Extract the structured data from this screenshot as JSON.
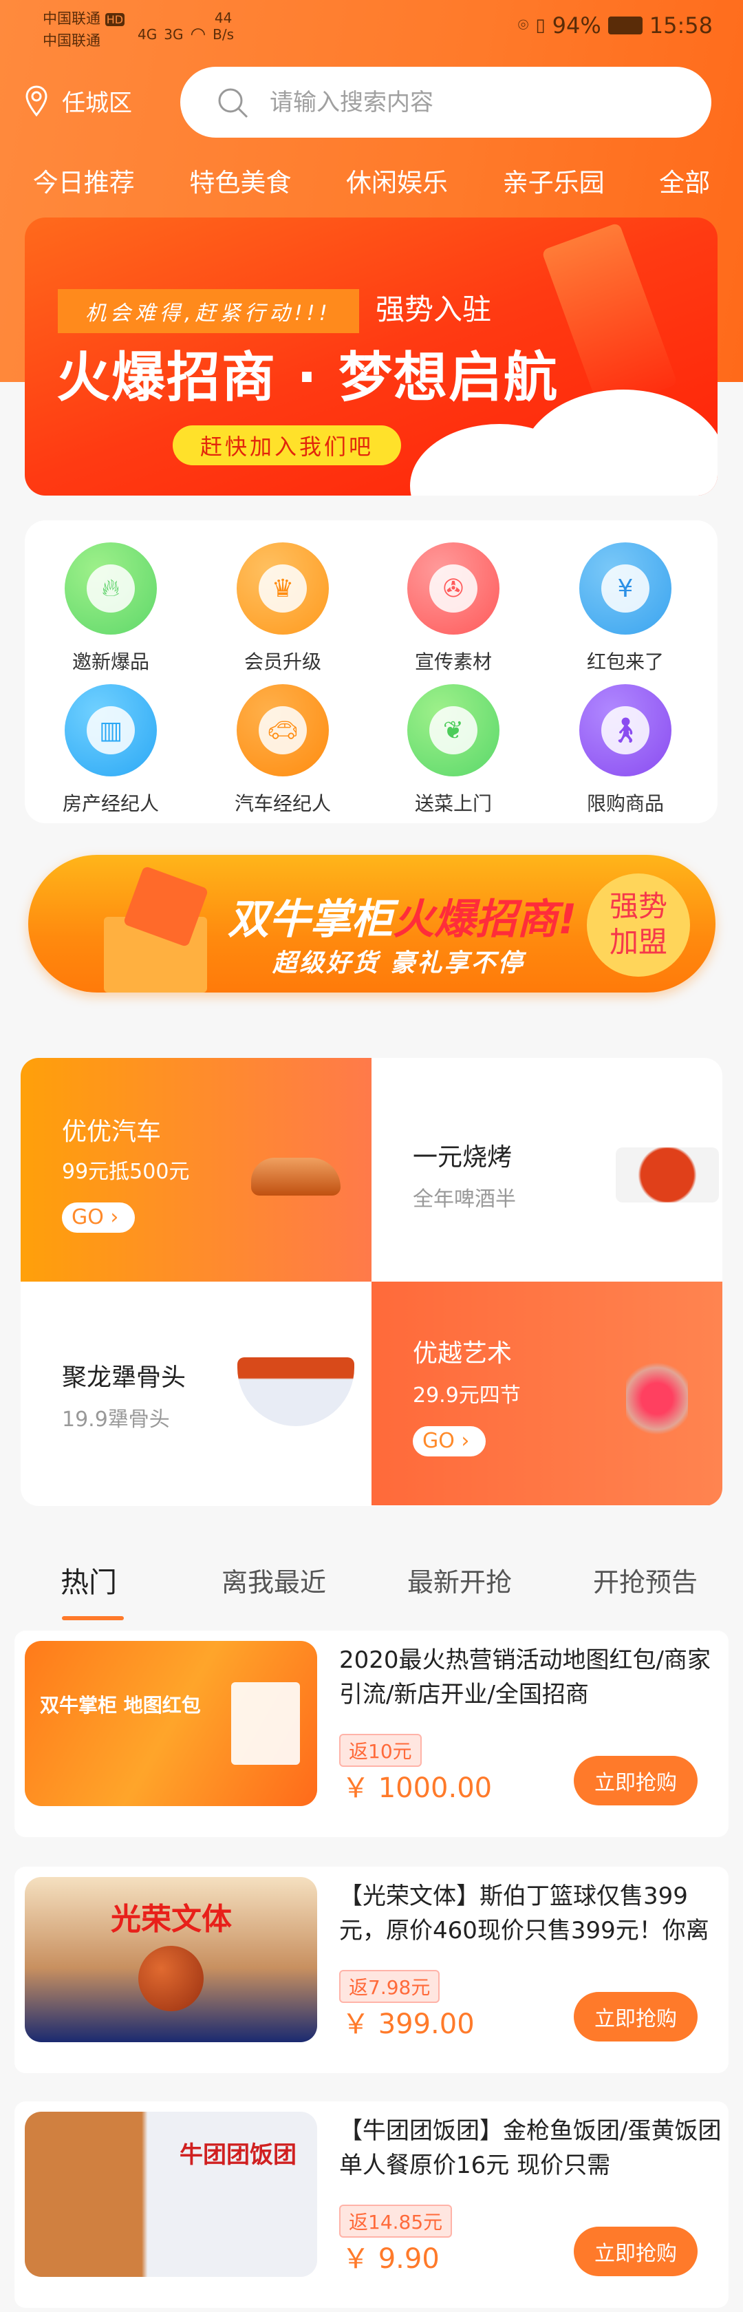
{
  "status_bar": {
    "carrier1": "中国联通",
    "carrier2": "中国联通",
    "hd": "HD",
    "net1": "4G",
    "net2": "3G",
    "speed": "44",
    "speed_unit": "B/s",
    "battery": "94%",
    "time": "15:58"
  },
  "header": {
    "location": "任城区",
    "search_placeholder": "请输入搜索内容"
  },
  "categories": [
    "今日推荐",
    "特色美食",
    "休闲娱乐",
    "亲子乐园",
    "全部"
  ],
  "banner": {
    "tag": "机会难得,赶紧行动!!!",
    "sub": "强势入驻",
    "title": "火爆招商 · 梦想启航",
    "button": "赶快加入我们吧"
  },
  "icons": [
    {
      "label": "邀新爆品",
      "icon": "flame-icon",
      "color": "#5fd86a"
    },
    {
      "label": "会员升级",
      "icon": "crown-icon",
      "color": "#ff9a1e"
    },
    {
      "label": "宣传素材",
      "icon": "film-reel-icon",
      "color": "#ff5a5a"
    },
    {
      "label": "红包来了",
      "icon": "red-packet-icon",
      "color": "#3aa4ef"
    },
    {
      "label": "房产经纪人",
      "icon": "building-icon",
      "color": "#2ba8f5"
    },
    {
      "label": "汽车经纪人",
      "icon": "car-icon",
      "color": "#ff8c10"
    },
    {
      "label": "送菜上门",
      "icon": "vegetable-icon",
      "color": "#5ad86a"
    },
    {
      "label": "限购商品",
      "icon": "walking-person-icon",
      "color": "#8a4cf0"
    }
  ],
  "promo": {
    "title_a": "双牛掌柜",
    "title_b": "火爆招商!",
    "sub": "超级好货 豪礼享不停",
    "badge_1": "强势",
    "badge_2": "加盟"
  },
  "grid": [
    {
      "title": "优优汽车",
      "sub": "99元抵500元",
      "go": "GO"
    },
    {
      "title": "一元烧烤",
      "sub": "全年啤酒半"
    },
    {
      "title": "聚龙犟骨头",
      "sub": "19.9犟骨头"
    },
    {
      "title": "优越艺术",
      "sub": "29.9元四节",
      "go": "GO"
    }
  ],
  "tabs": [
    "热门",
    "离我最近",
    "最新开抢",
    "开抢预告"
  ],
  "products": [
    {
      "title": "2020最火热营销活动地图红包/商家引流/新店开业/全国招商",
      "rebate": "返10元",
      "price": "￥ 1000.00",
      "button": "立即抢购",
      "thumb_text": "双牛掌柜 地图红包"
    },
    {
      "title": "【光荣文体】斯伯丁篮球仅售399元，原价460现价只售399元！你离",
      "rebate": "返7.98元",
      "price": "￥ 399.00",
      "button": "立即抢购",
      "thumb_text": "光荣文体"
    },
    {
      "title": "【牛团团饭团】金枪鱼饭团/蛋黄饭团单人餐原价16元  现价只需",
      "rebate": "返14.85元",
      "price": "￥ 9.90",
      "button": "立即抢购",
      "thumb_text": "牛团团饭团"
    }
  ]
}
